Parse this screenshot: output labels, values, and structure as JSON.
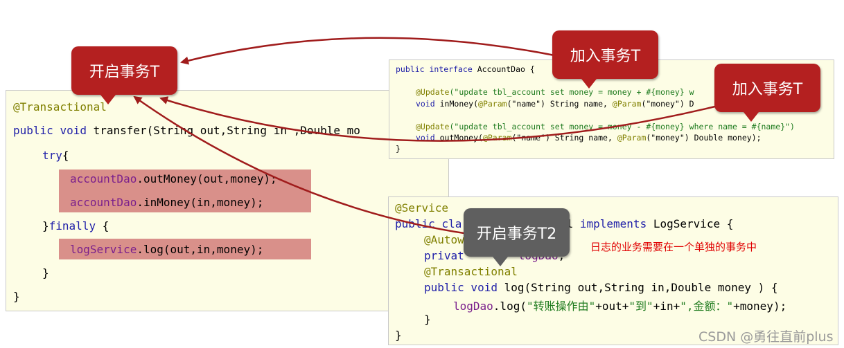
{
  "left_panel": {
    "annotation": "@Transactional",
    "sig_kw1": "public",
    "sig_kw2": "void",
    "sig_name": "transfer",
    "sig_rest": "(String out,String in ,Double mo",
    "try_kw": "try",
    "try_brace": "{",
    "line1_var": "accountDao",
    "line1_rest": ".outMoney(out,money);",
    "line2_var": "accountDao",
    "line2_rest": ".inMoney(in,money);",
    "finally_open": "}",
    "finally_kw": "finally",
    "finally_brace": " {",
    "line3_var": "logService",
    "line3_rest": ".log(out,in,money);",
    "close_inner": "}",
    "close_outer": "}"
  },
  "dao_panel": {
    "l1_kw": "public interface",
    "l1_rest": " AccountDao {",
    "l2_ann": "@Update",
    "l2_str": "(\"update tbl_account set money = money + #{money} w",
    "l2_tail": ")",
    "l3_kw": "void",
    "l3_a": " inMoney(",
    "l3_ann1": "@Param",
    "l3_b": "(\"name\") String name, ",
    "l3_ann2": "@Param",
    "l3_c": "(\"money\") D",
    "l4_ann": "@Update",
    "l4_str": "(\"update tbl_account set money = money - #{money} where name = #{name}\")",
    "l5_kw": "void",
    "l5_a": " outMoney(",
    "l5_ann1": "@Param",
    "l5_b": "(\"name\") String name, ",
    "l5_ann2": "@Param",
    "l5_c": "(\"money\") Double money);",
    "l6": "}"
  },
  "log_panel": {
    "l1_ann": "@Service",
    "l2_kw": "public cla",
    "l2_mid": "mpl",
    "l2_kw2": " implements",
    "l2_rest": " LogService {",
    "l3_ann": "@Autow",
    "l4_kw": "privat",
    "l4_var": "logDao",
    "l4_rest": ";",
    "l5_ann": "@Transactional",
    "l6_kw": "public void",
    "l6_rest": " log(String out,String in,Double money ) {",
    "l7_var": "logDao",
    "l7_a": ".log(",
    "l7_s1": "\"转账操作由\"",
    "l7_b": "+out+",
    "l7_s2": "\"到\"",
    "l7_c": "+in+",
    "l7_s3": "\",金额：\"",
    "l7_d": "+money);",
    "l8": "}",
    "l9": "}"
  },
  "callouts": {
    "left": "开启事务T",
    "top_right": "加入事务T",
    "right": "加入事务T",
    "middle": "开启事务T2"
  },
  "note": "日志的业务需要在一个单独的事务中",
  "watermark": "CSDN @勇往直前plus",
  "colors": {
    "callout_red": "#b42020",
    "callout_gray": "#5f5f5f",
    "arrow": "#a01c1c",
    "highlight": "#d9908a",
    "panel_bg": "#fdfde5",
    "note": "#e00000"
  }
}
